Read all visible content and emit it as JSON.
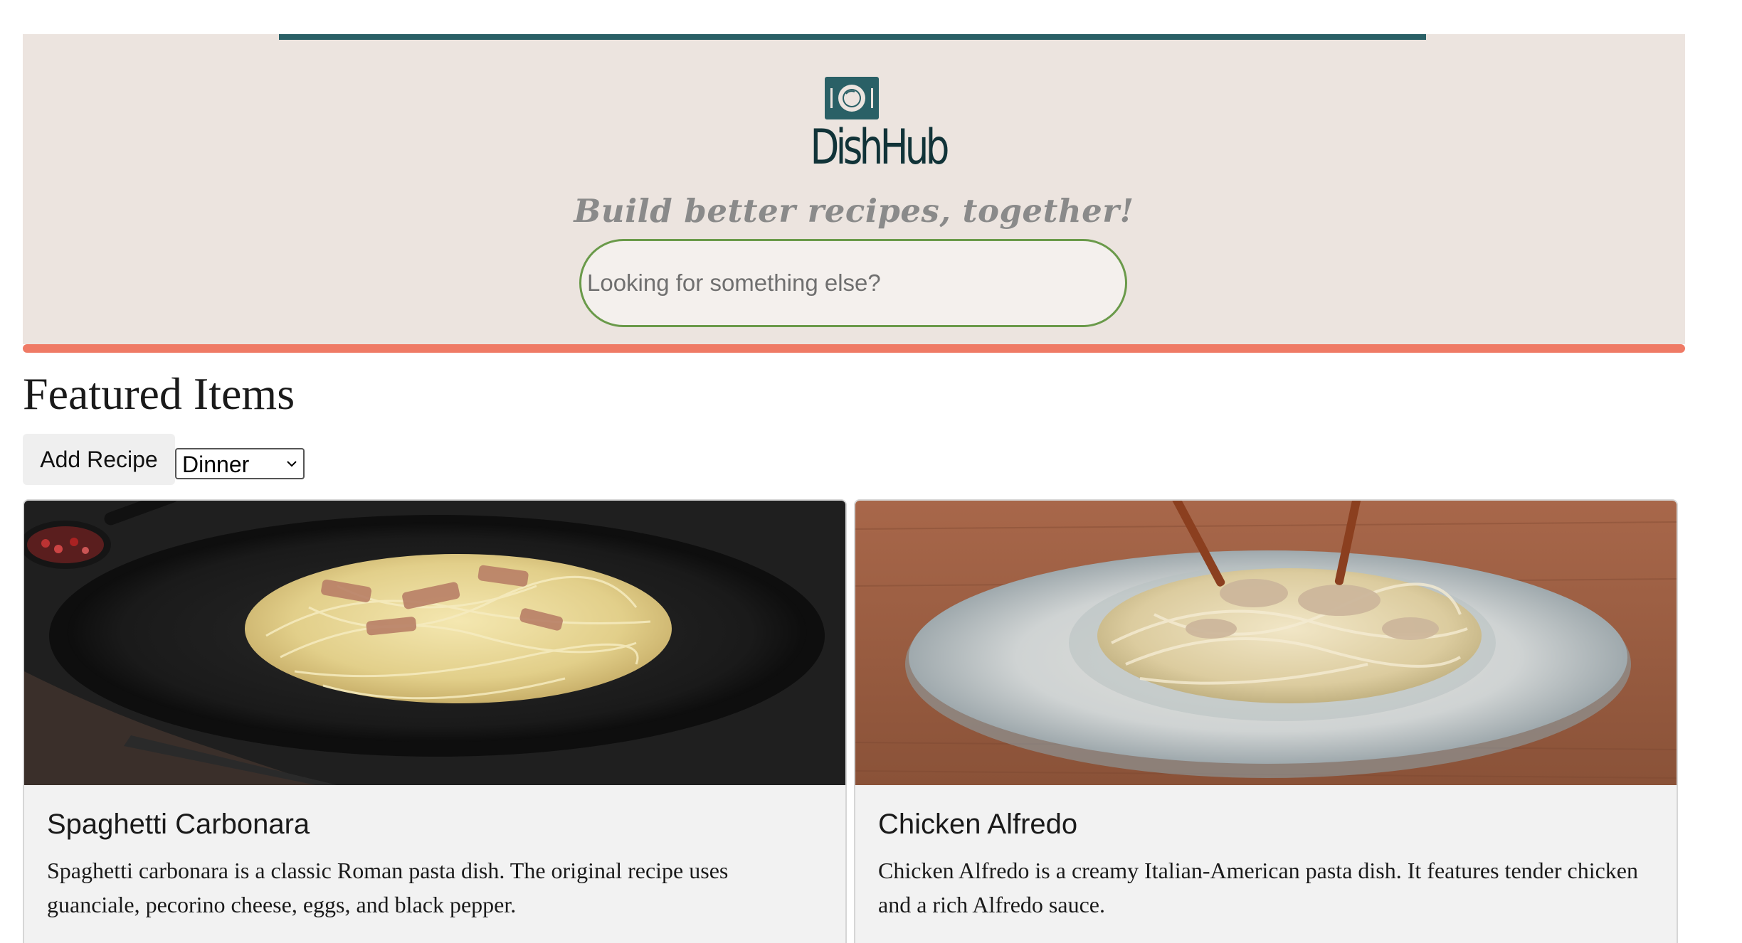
{
  "header": {
    "brand": "DishHub",
    "tagline": "Build better recipes, together!",
    "search": {
      "placeholder": "Looking for something else?",
      "value": ""
    },
    "colors": {
      "background": "#ece4df",
      "top_bar": "#2a6066",
      "bottom_bar": "#ef7a65",
      "logo": "#113338"
    }
  },
  "main": {
    "section_title": "Featured Items",
    "add_recipe_label": "Add Recipe",
    "category_select": {
      "selected": "Dinner",
      "icon": "chevron-down-icon"
    },
    "recipes": [
      {
        "title": "Spaghetti Carbonara",
        "description": "Spaghetti carbonara is a classic Roman pasta dish. The original recipe uses guanciale, pecorino cheese, eggs, and black pepper."
      },
      {
        "title": "Chicken Alfredo",
        "description": "Chicken Alfredo is a creamy Italian-American pasta dish. It features tender chicken and a rich Alfredo sauce."
      }
    ]
  }
}
